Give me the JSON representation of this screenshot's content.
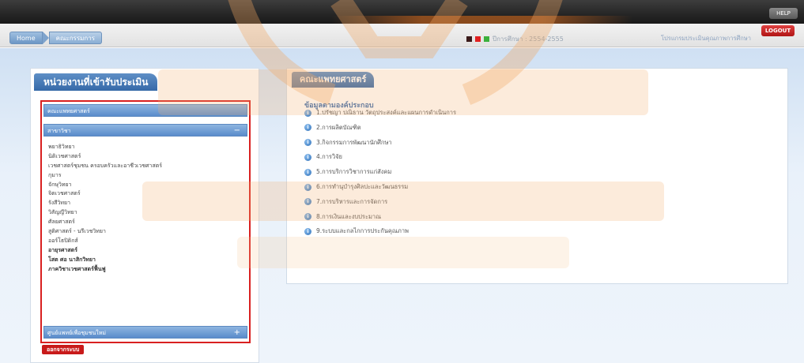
{
  "topbar": {
    "help_label": "HELP"
  },
  "breadcrumb": {
    "home": "Home",
    "current": "คณะกรรมการ"
  },
  "status": {
    "info_text": "ปีการศึกษา : 2554-2555",
    "legend_colors": [
      "#3a1a1a",
      "#e02020",
      "#3cb03c"
    ],
    "user_text": "โปรแกรมประเมินคุณภาพการศึกษา"
  },
  "logout_top": "LOGOUT",
  "left": {
    "title": "หน่วยงานที่เข้ารับประเมิน",
    "groups": [
      {
        "label": "คณะแพทยศาสตร์"
      },
      {
        "label": "สาขาวิชา",
        "toggle": "−"
      }
    ],
    "items": [
      {
        "label": "พยาธิวิทยา",
        "bold": false
      },
      {
        "label": "นิติเวชศาสตร์",
        "bold": false
      },
      {
        "label": "เวชศาสตร์ชุมชน ครอบครัวและอาชีวเวชศาสตร์",
        "bold": false
      },
      {
        "label": "กุมาร",
        "bold": false
      },
      {
        "label": "จักษุวิทยา",
        "bold": false
      },
      {
        "label": "จิตเวชศาสตร์",
        "bold": false
      },
      {
        "label": "รังสีวิทยา",
        "bold": false
      },
      {
        "label": "วิสัญญีวิทยา",
        "bold": false
      },
      {
        "label": "ศัลยศาสตร์",
        "bold": false
      },
      {
        "label": "สูติศาสตร์ - นรีเวชวิทยา",
        "bold": false
      },
      {
        "label": "ออร์โธปิดิกส์",
        "bold": false
      },
      {
        "label": "อายุรศาสตร์",
        "bold": true
      },
      {
        "label": "โสต ศอ นาสิกวิทยา",
        "bold": true
      },
      {
        "label": "ภาควิชาเวชศาสตร์ฟื้นฟู",
        "bold": true
      }
    ],
    "bottom_group": {
      "label": "ศูนย์แพทย์เพื่อชุมชนใหม่",
      "toggle": "+"
    },
    "logout_label": "ออกจากระบบ"
  },
  "right": {
    "title": "คณะแพทยศาสตร์",
    "section": "ข้อมูลตามองค์ประกอบ",
    "menu": [
      "1.ปรัชญา ปณิธาน วัตถุประสงค์และแผนการดำเนินการ",
      "2.การผลิตบัณฑิต",
      "3.กิจกรรมการพัฒนานักศึกษา",
      "4.การวิจัย",
      "5.การบริการวิชาการแก่สังคม",
      "6.การทำนุบำรุงศิลปะและวัฒนธรรม",
      "7.การบริหารและการจัดการ",
      "8.การเงินและงบประมาณ",
      "9.ระบบและกลไกการประกันคุณภาพ"
    ]
  }
}
